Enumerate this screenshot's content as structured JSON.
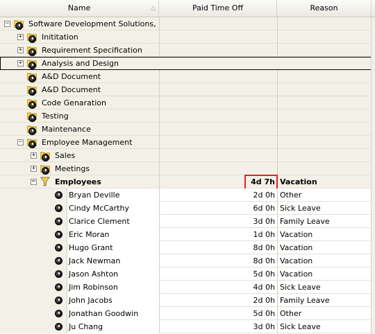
{
  "columns": {
    "name": "Name",
    "pto": "Paid Time Off",
    "reason": "Reason"
  },
  "tree": {
    "root": "Software Development Solutions, Inc.",
    "groups": [
      {
        "label": "Inititation",
        "expander": "+"
      },
      {
        "label": "Requirement Specification",
        "expander": "+"
      },
      {
        "label": "Analysis and Design",
        "expander": "+"
      },
      {
        "label": "A&D Document"
      },
      {
        "label": "A&D Document"
      },
      {
        "label": "Code Genaration"
      },
      {
        "label": "Testing"
      },
      {
        "label": "Maintenance"
      },
      {
        "label": "Employee Management",
        "expander": "−"
      },
      {
        "label": "Sales",
        "expander": "+"
      },
      {
        "label": "Meetings",
        "expander": "+"
      }
    ],
    "employees_group": {
      "label": "Employees",
      "pto": "4d 7h",
      "reason": "Vacation",
      "expander": "−"
    },
    "employees": [
      {
        "name": "Bryan Deville",
        "pto": "2d 0h",
        "reason": "Other"
      },
      {
        "name": "Cindy McCarthy",
        "pto": "6d 0h",
        "reason": "Sick Leave"
      },
      {
        "name": "Clarice Clement",
        "pto": "3d 0h",
        "reason": "Family Leave"
      },
      {
        "name": "Eric Moran",
        "pto": "1d 0h",
        "reason": "Vacation"
      },
      {
        "name": "Hugo Grant",
        "pto": "8d 0h",
        "reason": "Vacation"
      },
      {
        "name": "Jack Newman",
        "pto": "8d 0h",
        "reason": "Vacation"
      },
      {
        "name": "Jason Ashton",
        "pto": "5d 0h",
        "reason": "Vacation"
      },
      {
        "name": "Jim Robinson",
        "pto": "4d 0h",
        "reason": "Sick Leave"
      },
      {
        "name": "John Jacobs",
        "pto": "2d 0h",
        "reason": "Family Leave"
      },
      {
        "name": "Jonathan Goodwin",
        "pto": "5d 0h",
        "reason": "Other"
      },
      {
        "name": "Ju Chang",
        "pto": "3d 0h",
        "reason": "Sick Leave"
      }
    ]
  },
  "icons": {
    "folder": "folder-icon",
    "clock": "clock-icon",
    "filter": "filter-icon",
    "sort": "sort-indicator-icon"
  },
  "colors": {
    "group_bg": "#f3f1e7",
    "highlight": "#e0201f"
  }
}
